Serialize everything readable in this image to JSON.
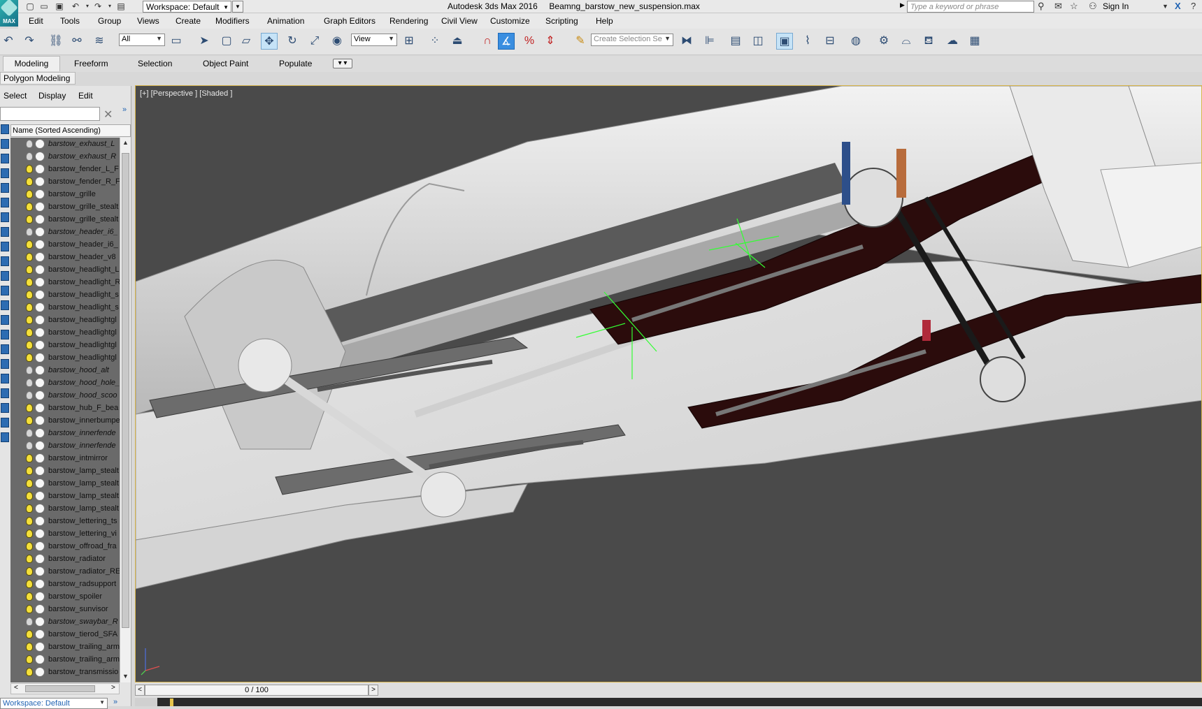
{
  "titlebar": {
    "app_logo_text": "MAX",
    "workspace": "Workspace: Default",
    "window_title": "Autodesk 3ds Max 2016     Beamng_barstow_new_suspension.max",
    "search_placeholder": "Type a keyword or phrase",
    "sign_in": "Sign In"
  },
  "menubar": {
    "items": [
      "Edit",
      "Tools",
      "Group",
      "Views",
      "Create",
      "Modifiers",
      "Animation",
      "Graph Editors",
      "Rendering",
      "Civil View",
      "Customize",
      "Scripting",
      "Help"
    ]
  },
  "main_toolbar": {
    "selection_filter": "All",
    "reference_coord": "View",
    "named_selection_placeholder": "Create Selection Se"
  },
  "ribbon": {
    "tabs": [
      "Modeling",
      "Freeform",
      "Selection",
      "Object Paint",
      "Populate"
    ],
    "active_sub": "Polygon Modeling"
  },
  "scene_explorer": {
    "menu": [
      "Select",
      "Display",
      "Edit"
    ],
    "column_header": "Name (Sorted Ascending)",
    "objects": [
      {
        "name": "barstow_exhaust_L",
        "italic": true,
        "light_on": false
      },
      {
        "name": "barstow_exhaust_R",
        "italic": true,
        "light_on": false
      },
      {
        "name": "barstow_fender_L_F",
        "italic": false,
        "light_on": true
      },
      {
        "name": "barstow_fender_R_F",
        "italic": false,
        "light_on": true
      },
      {
        "name": "barstow_grille",
        "italic": false,
        "light_on": true
      },
      {
        "name": "barstow_grille_stealt",
        "italic": false,
        "light_on": true
      },
      {
        "name": "barstow_grille_stealt",
        "italic": false,
        "light_on": true
      },
      {
        "name": "barstow_header_i6_",
        "italic": true,
        "light_on": false
      },
      {
        "name": "barstow_header_i6_",
        "italic": false,
        "light_on": true
      },
      {
        "name": "barstow_header_v8",
        "italic": false,
        "light_on": true
      },
      {
        "name": "barstow_headlight_L",
        "italic": false,
        "light_on": true
      },
      {
        "name": "barstow_headlight_R",
        "italic": false,
        "light_on": true
      },
      {
        "name": "barstow_headlight_s",
        "italic": false,
        "light_on": true
      },
      {
        "name": "barstow_headlight_s",
        "italic": false,
        "light_on": true
      },
      {
        "name": "barstow_headlightgl",
        "italic": false,
        "light_on": true
      },
      {
        "name": "barstow_headlightgl",
        "italic": false,
        "light_on": true
      },
      {
        "name": "barstow_headlightgl",
        "italic": false,
        "light_on": true
      },
      {
        "name": "barstow_headlightgl",
        "italic": false,
        "light_on": true
      },
      {
        "name": "barstow_hood_alt",
        "italic": true,
        "light_on": false
      },
      {
        "name": "barstow_hood_hole_",
        "italic": true,
        "light_on": false
      },
      {
        "name": "barstow_hood_scoo",
        "italic": true,
        "light_on": false
      },
      {
        "name": "barstow_hub_F_bea",
        "italic": false,
        "light_on": true
      },
      {
        "name": "barstow_innerbumpe",
        "italic": false,
        "light_on": true
      },
      {
        "name": "barstow_innerfende",
        "italic": true,
        "light_on": false
      },
      {
        "name": "barstow_innerfende",
        "italic": true,
        "light_on": false
      },
      {
        "name": "barstow_intmirror",
        "italic": false,
        "light_on": true
      },
      {
        "name": "barstow_lamp_stealt",
        "italic": false,
        "light_on": true
      },
      {
        "name": "barstow_lamp_stealt",
        "italic": false,
        "light_on": true
      },
      {
        "name": "barstow_lamp_stealt",
        "italic": false,
        "light_on": true
      },
      {
        "name": "barstow_lamp_stealt",
        "italic": false,
        "light_on": true
      },
      {
        "name": "barstow_lettering_ts",
        "italic": false,
        "light_on": true
      },
      {
        "name": "barstow_lettering_vi",
        "italic": false,
        "light_on": true
      },
      {
        "name": "barstow_offroad_fra",
        "italic": false,
        "light_on": true
      },
      {
        "name": "barstow_radiator",
        "italic": false,
        "light_on": true
      },
      {
        "name": "barstow_radiator_RE",
        "italic": false,
        "light_on": true
      },
      {
        "name": "barstow_radsupport",
        "italic": false,
        "light_on": true
      },
      {
        "name": "barstow_spoiler",
        "italic": false,
        "light_on": true
      },
      {
        "name": "barstow_sunvisor",
        "italic": false,
        "light_on": true
      },
      {
        "name": "barstow_swaybar_R",
        "italic": true,
        "light_on": false
      },
      {
        "name": "barstow_tierod_SFA",
        "italic": false,
        "light_on": true
      },
      {
        "name": "barstow_trailing_arm",
        "italic": false,
        "light_on": true
      },
      {
        "name": "barstow_trailing_arm",
        "italic": false,
        "light_on": true
      },
      {
        "name": "barstow_transmissio",
        "italic": false,
        "light_on": true
      }
    ],
    "workspace_bottom": "Workspace: Default"
  },
  "viewport": {
    "label": "[+] [Perspective ] [Shaded ]"
  },
  "timebar": {
    "frame_readout": "0 / 100",
    "prev": "<",
    "next": ">"
  },
  "colors": {
    "viewport_bg": "#4a4a4a",
    "selection_gizmo": "#33ff33",
    "active_border": "#d8b54a",
    "frame_red": "#3a1010"
  }
}
